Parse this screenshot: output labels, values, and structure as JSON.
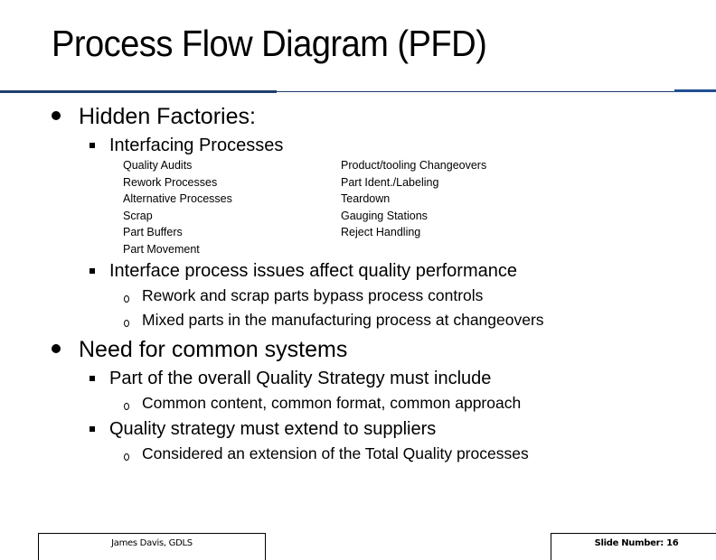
{
  "slide": {
    "title": "Process Flow Diagram (PFD)",
    "accent_color": "#1f3f6e",
    "sections": [
      {
        "heading": "Hidden Factories:",
        "subitems": [
          {
            "text": "Interfacing Processes",
            "columns": [
              [
                "Quality Audits",
                "Rework Processes",
                "Alternative Processes",
                "Scrap",
                "Part Buffers",
                "Part Movement"
              ],
              [
                "Product/tooling Changeovers",
                "Part Ident./Labeling",
                "Teardown",
                "Gauging Stations",
                "Reject Handling"
              ]
            ]
          },
          {
            "text": "Interface process issues affect quality performance",
            "points": [
              "Rework and scrap parts bypass process controls",
              "Mixed parts in the manufacturing process at changeovers"
            ]
          }
        ]
      },
      {
        "heading": "Need for common systems",
        "subitems": [
          {
            "text": "Part of the overall Quality Strategy must include",
            "points": [
              "Common content, common format, common approach"
            ]
          },
          {
            "text": "Quality strategy must extend to suppliers",
            "points": [
              "Considered an extension of the Total Quality processes"
            ]
          }
        ]
      }
    ]
  },
  "footer": {
    "author": "James Davis, GDLS",
    "slide_number": "Slide Number: 16"
  }
}
